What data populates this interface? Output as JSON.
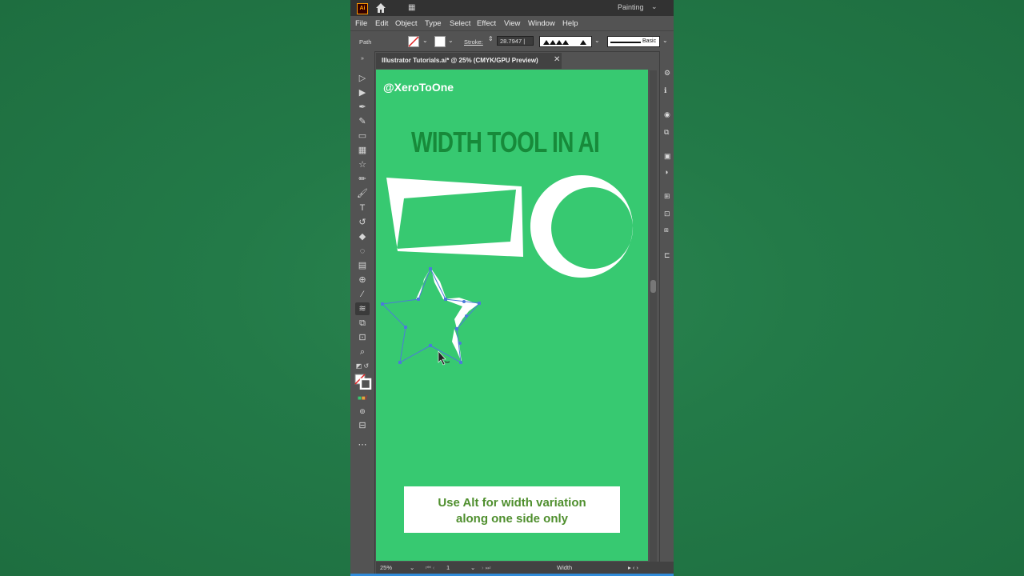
{
  "app": {
    "logo_text": "Ai",
    "workspace": "Painting",
    "tab_title": "Illustrator Tutorials.ai* @ 25% (CMYK/GPU Preview)"
  },
  "menu": [
    "File",
    "Edit",
    "Object",
    "Type",
    "Select",
    "Effect",
    "View",
    "Window",
    "Help"
  ],
  "control_bar": {
    "selection": "Path",
    "stroke_label": "Stroke:",
    "stroke_value": "28.7947 |",
    "brush_label": "Basic"
  },
  "artboard": {
    "handle": "@XeroToOne",
    "heading": "WIDTH TOOL IN AI",
    "caption_line1": "Use Alt for width variation",
    "caption_line2": "along one side only",
    "background_color": "#37c971"
  },
  "status_bar": {
    "zoom": "25%",
    "page": "1",
    "tool_name": "Width"
  },
  "icons": [
    "home-icon",
    "selection-tool-icon",
    "direct-selection-icon",
    "pen-icon",
    "curvature-icon",
    "rectangle-icon",
    "grid-icon",
    "star-icon",
    "pencil-icon",
    "paintbrush-icon",
    "type-icon",
    "rotate-icon",
    "eraser-icon",
    "shape-builder-icon",
    "gradient-icon",
    "mesh-icon",
    "eyedropper-icon",
    "width-tool-icon",
    "free-transform-icon",
    "artboard-icon",
    "zoom-icon",
    "more-tools-icon"
  ]
}
